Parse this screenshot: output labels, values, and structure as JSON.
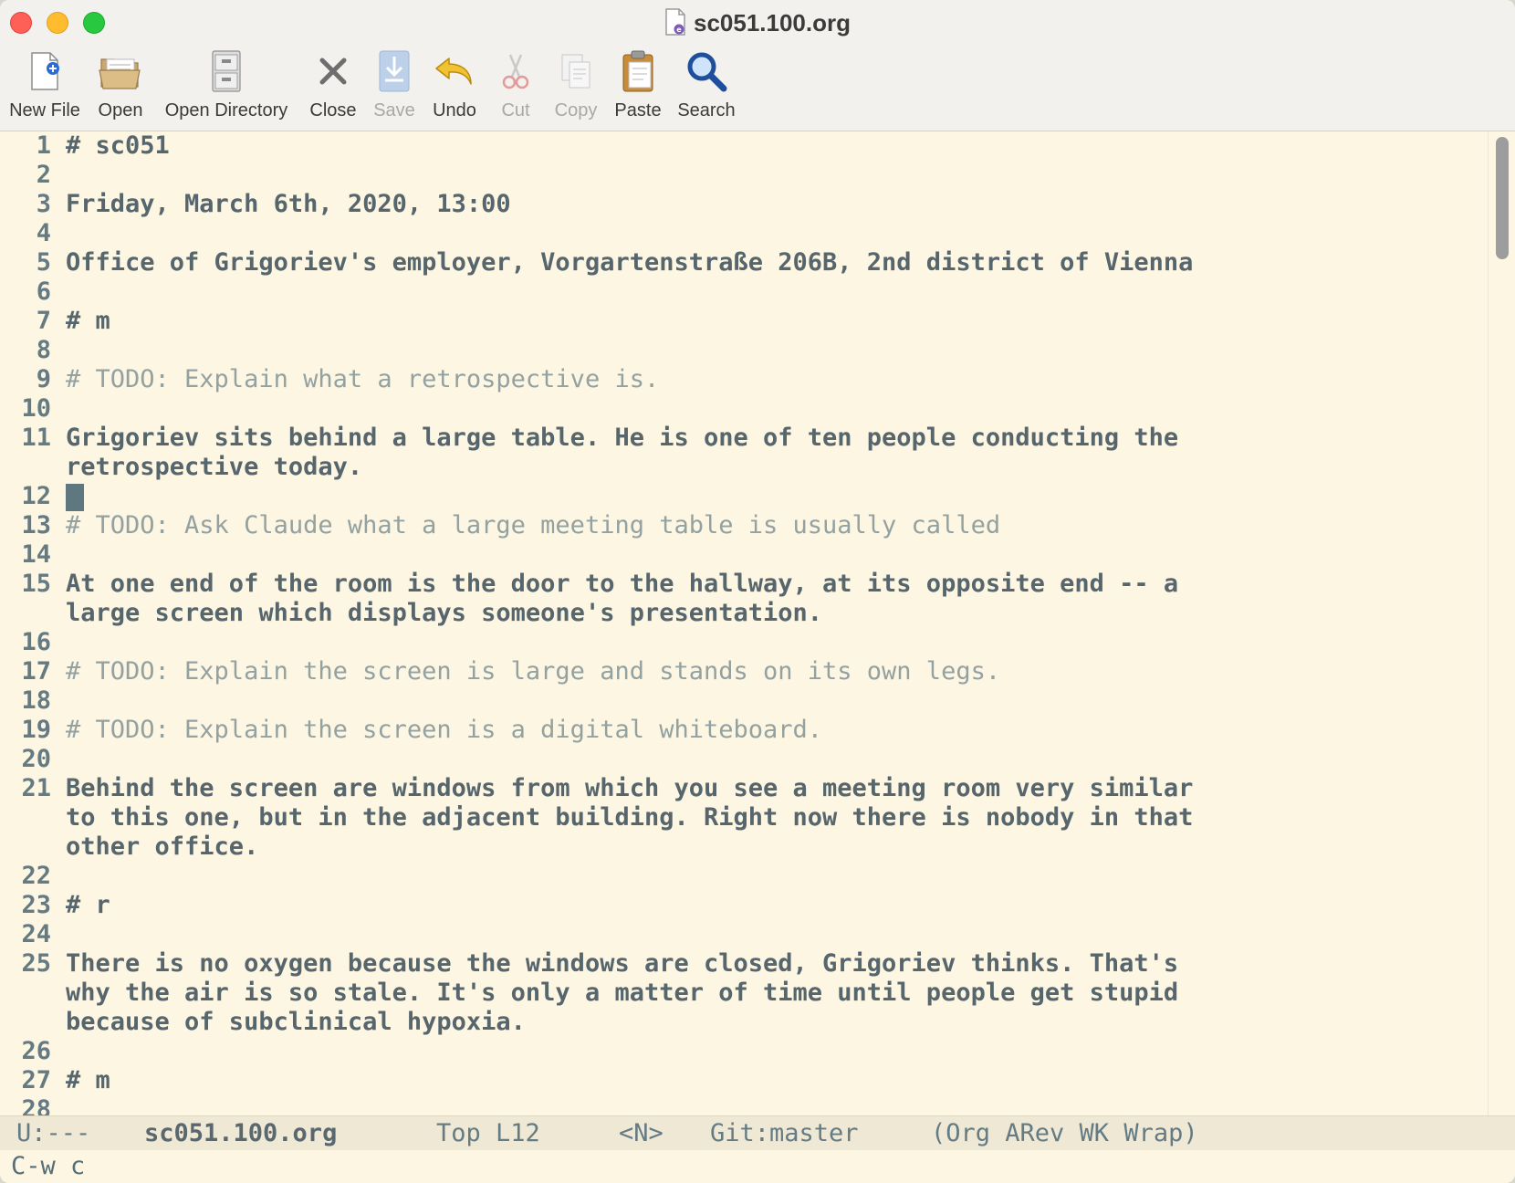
{
  "window": {
    "title": "sc051.100.org",
    "file_icon": "emacs-document-icon"
  },
  "toolbar": {
    "new_file": "New File",
    "open": "Open",
    "open_directory": "Open Directory",
    "close": "Close",
    "save": "Save",
    "undo": "Undo",
    "cut": "Cut",
    "copy": "Copy",
    "paste": "Paste",
    "search": "Search"
  },
  "editor": {
    "cursor_line": 12,
    "lines": [
      {
        "n": "1",
        "text": "# sc051",
        "kind": "heading"
      },
      {
        "n": "2",
        "text": ""
      },
      {
        "n": "3",
        "text": "Friday, March 6th, 2020, 13:00"
      },
      {
        "n": "4",
        "text": ""
      },
      {
        "n": "5",
        "text": "Office of Grigoriev's employer, Vorgartenstraße 206B, 2nd district of Vienna"
      },
      {
        "n": "6",
        "text": ""
      },
      {
        "n": "7",
        "text": "# m",
        "kind": "heading"
      },
      {
        "n": "8",
        "text": ""
      },
      {
        "n": "9",
        "text": "# TODO: Explain what a retrospective is.",
        "kind": "comment"
      },
      {
        "n": "10",
        "text": ""
      },
      {
        "n": "11",
        "text": "Grigoriev sits behind a large table. He is one of ten people conducting the",
        "cont": [
          "retrospective today."
        ]
      },
      {
        "n": "12",
        "text": ""
      },
      {
        "n": "13",
        "text": "# TODO: Ask Claude what a large meeting table is usually called",
        "kind": "comment"
      },
      {
        "n": "14",
        "text": ""
      },
      {
        "n": "15",
        "text": "At one end of the room is the door to the hallway, at its opposite end -- a",
        "cont": [
          "large screen which displays someone's presentation."
        ]
      },
      {
        "n": "16",
        "text": ""
      },
      {
        "n": "17",
        "text": "# TODO: Explain the screen is large and stands on its own legs.",
        "kind": "comment"
      },
      {
        "n": "18",
        "text": ""
      },
      {
        "n": "19",
        "text": "# TODO: Explain the screen is a digital whiteboard.",
        "kind": "comment"
      },
      {
        "n": "20",
        "text": ""
      },
      {
        "n": "21",
        "text": "Behind the screen are windows from which you see a meeting room very similar",
        "cont": [
          "to this one, but in the adjacent building. Right now there is nobody in that",
          "other office."
        ]
      },
      {
        "n": "22",
        "text": ""
      },
      {
        "n": "23",
        "text": "# r",
        "kind": "heading"
      },
      {
        "n": "24",
        "text": ""
      },
      {
        "n": "25",
        "text": "There is no oxygen because the windows are closed, Grigoriev thinks. That's",
        "cont": [
          "why the air is so stale. It's only a matter of time until people get stupid",
          "because of subclinical hypoxia."
        ]
      },
      {
        "n": "26",
        "text": ""
      },
      {
        "n": "27",
        "text": "# m",
        "kind": "heading"
      },
      {
        "n": "28",
        "text": ""
      }
    ]
  },
  "modeline": {
    "status": "U:---",
    "buffer": "sc051.100.org",
    "position": "Top L12",
    "state": "<N>",
    "vc": "Git:master",
    "modes": "(Org ARev WK Wrap)"
  },
  "minibuffer": {
    "text": "C-w c"
  },
  "colors": {
    "background": "#fdf6e3",
    "text": "#56666c",
    "comment": "#93a1a1",
    "cursor": "#5f7880",
    "modeline_bg": "#eee8d5"
  }
}
